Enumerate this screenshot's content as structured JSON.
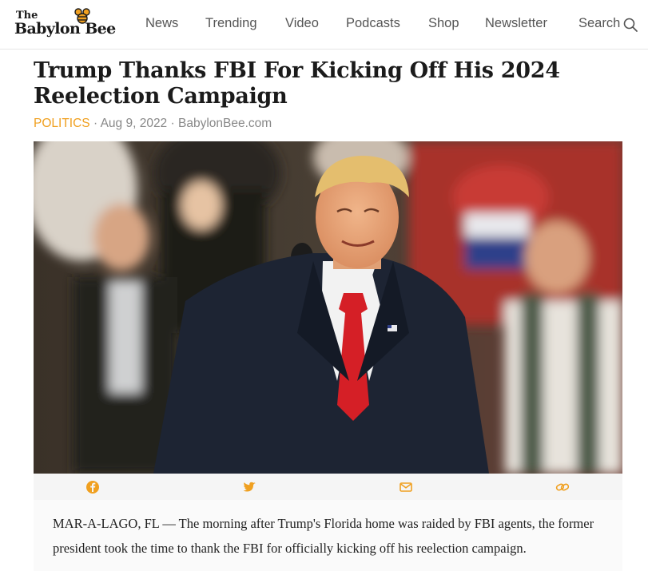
{
  "logo": {
    "the": "The",
    "name": "Babylon Bee",
    "bee_icon": "bee-icon"
  },
  "nav": {
    "items": [
      "News",
      "Trending",
      "Video",
      "Podcasts",
      "Shop",
      "Newsletter",
      "Search"
    ],
    "search_icon": "magnifier-icon"
  },
  "article": {
    "title": "Trump Thanks FBI For Kicking Off His 2024 Reelection Campaign",
    "category": "POLITICS",
    "separator": "·",
    "date": "Aug 9, 2022",
    "source": "BabylonBee.com",
    "photo_alt": "Donald Trump smiling at a rally podium",
    "body": "MAR-A-LAGO, FL — The morning after Trump's Florida home was raided by FBI agents, the former president took the time to thank the FBI for officially kicking off his reelection campaign."
  },
  "share": {
    "icons": [
      "facebook-icon",
      "twitter-icon",
      "email-icon",
      "link-icon"
    ]
  },
  "colors": {
    "accent": "#f0a020",
    "share_icon": "#f0a020",
    "text": "#222222",
    "muted": "#888888"
  }
}
